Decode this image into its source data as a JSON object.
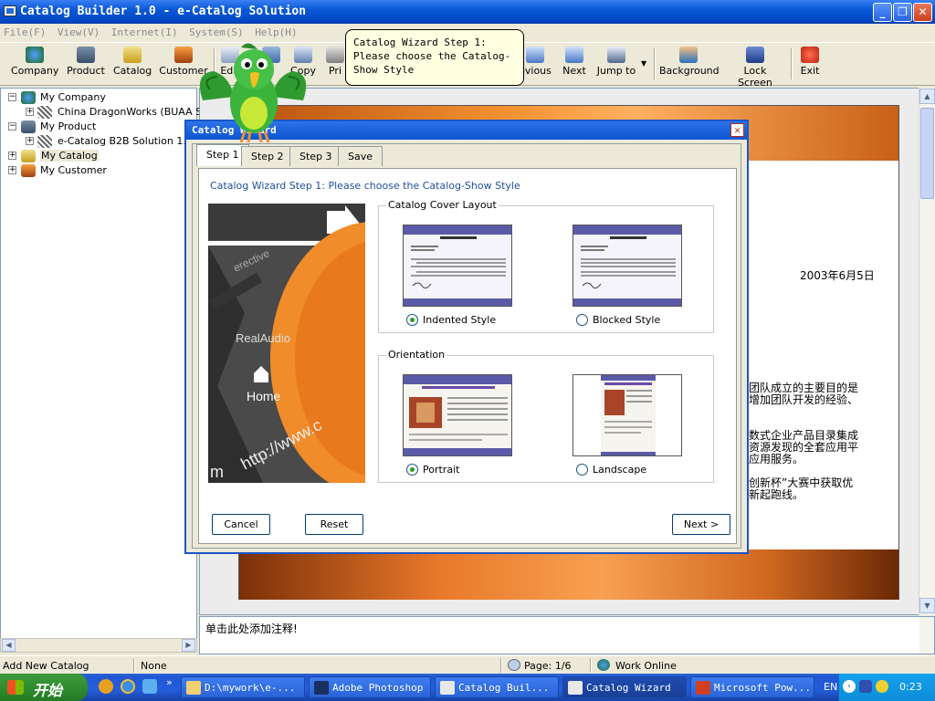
{
  "window": {
    "title": "Catalog Builder 1.0 - e-Catalog Solution"
  },
  "menu": [
    "File(F)",
    "View(V)",
    "Internet(I)",
    "System(S)",
    "Help(H)"
  ],
  "toolbar": {
    "company": "Company",
    "product": "Product",
    "catalog": "Catalog",
    "customer": "Customer",
    "edit": "Edit",
    "save_partial": "e",
    "copy": "Copy",
    "print_partial": "Pri",
    "previous_partial": "evious",
    "next": "Next",
    "jump_to": "Jump to",
    "background": "Background",
    "lock_screen": "Lock Screen",
    "exit": "Exit"
  },
  "tooltip": {
    "text": "Catalog Wizard Step 1: Please choose the Catalog-Show Style"
  },
  "tree": {
    "my_company": "My Company",
    "company_child": "China DragonWorks (BUAA So",
    "my_product": "My Product",
    "product_child": "e-Catalog B2B Solution 1.0",
    "my_catalog": "My Catalog",
    "my_customer": "My Customer"
  },
  "document": {
    "date": "2003年6月5日",
    "lines": [
      "团队成立的主要目的是",
      "增加团队开发的经验、",
      "数式企业产品目录集成",
      "资源发现的全套应用平",
      "应用服务。",
      "创新杯”大赛中获取优",
      "新起跑线。"
    ]
  },
  "notes": {
    "text": "单击此处添加注释!"
  },
  "status": {
    "left": "Add New Catalog",
    "mid": "None",
    "page": "Page: 1/6",
    "online": "Work Online"
  },
  "taskbar": {
    "start": "开始",
    "tasks": [
      "D:\\mywork\\e-...",
      "Adobe Photoshop",
      "Catalog Buil...",
      "Catalog Wizard",
      "Microsoft Pow..."
    ],
    "lang": "EN",
    "clock": "0:23"
  },
  "dialog": {
    "title": "Catalog Wizard",
    "tabs": [
      "Step 1",
      "Step 2",
      "Step 3",
      "Save"
    ],
    "heading": "Catalog Wizard Step 1: Please choose the Catalog-Show Style",
    "cover_group": "Catalog Cover Layout",
    "indented": "Indented Style",
    "blocked": "Blocked Style",
    "orientation_group": "Orientation",
    "portrait": "Portrait",
    "landscape": "Landscape",
    "cancel": "Cancel",
    "reset": "Reset",
    "next": "Next >",
    "image_text": {
      "home": "Home",
      "url": "http://www.c",
      "realaudio": "RealAudio",
      "interactive": "erective",
      "m": "m"
    }
  }
}
